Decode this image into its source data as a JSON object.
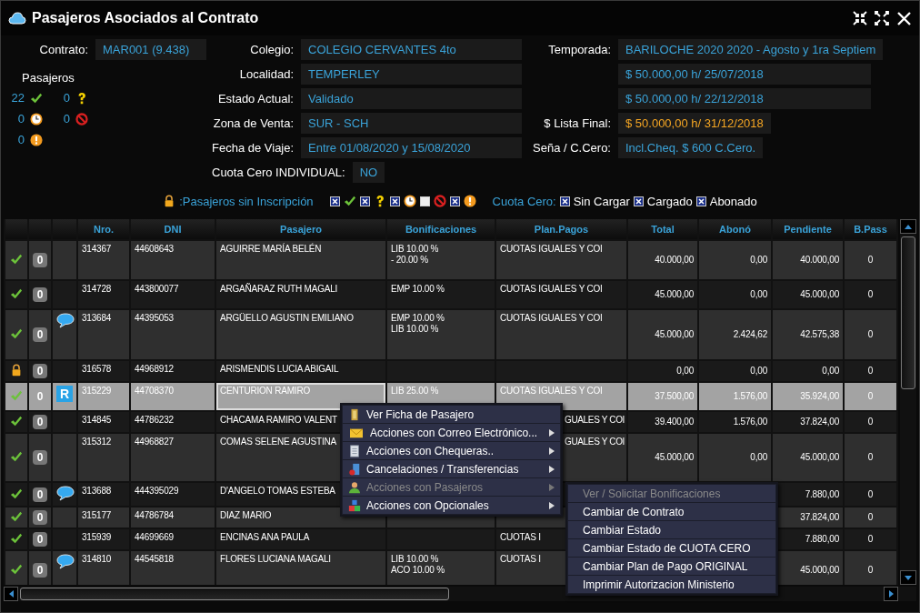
{
  "window": {
    "title": "Pasajeros Asociados al Contrato"
  },
  "contract": {
    "label": "Contrato:",
    "value": "MAR001 (9.438)"
  },
  "passenger_counts": {
    "title": "Pasajeros",
    "items": [
      {
        "kind": "ok",
        "count": "22"
      },
      {
        "kind": "question",
        "count": "0"
      },
      {
        "kind": "clock",
        "count": "0"
      },
      {
        "kind": "blocked",
        "count": "0"
      },
      {
        "kind": "warning",
        "count": "0"
      }
    ]
  },
  "details_middle": [
    {
      "kind": "field",
      "label": "Colegio:",
      "value": "COLEGIO CERVANTES 4to"
    },
    {
      "kind": "field",
      "label": "Localidad:",
      "value": "TEMPERLEY"
    },
    {
      "kind": "field",
      "label": "Estado Actual:",
      "value": "Validado"
    },
    {
      "kind": "field",
      "label": "Zona de Venta:",
      "value": "SUR - SCH"
    },
    {
      "kind": "field",
      "label": "Fecha de Viaje:",
      "value": "Entre 01/08/2020 y 15/08/2020"
    },
    {
      "kind": "compact",
      "label": "Cuota Cero INDIVIDUAL:",
      "value": "NO"
    }
  ],
  "details_right": [
    {
      "label": "Temporada:",
      "value": "BARILOCHE 2020 2020 - Agosto y 1ra Septiem",
      "highlight": false
    },
    {
      "value": "$ 50.000,00 h/ 25/07/2018",
      "highlight": false
    },
    {
      "value": "$ 50.000,00 h/ 22/12/2018",
      "highlight": false
    },
    {
      "label": "$ Lista Final:",
      "value": "$ 50.000,00 h/ 31/12/2018",
      "highlight": true
    },
    {
      "label": "Seña / C.Cero:",
      "value": "Incl.Cheq. $ 600 C.Cero.",
      "highlight": false
    }
  ],
  "legend": {
    "locked_label": ":Pasajeros sin Inscripción",
    "status_filters": [
      {
        "kind": "ok",
        "checked": true
      },
      {
        "kind": "question",
        "checked": true
      },
      {
        "kind": "clock",
        "checked": true
      },
      {
        "kind": "blocked",
        "checked": false
      },
      {
        "kind": "warning",
        "checked": true
      }
    ],
    "cuota_cero_label": "Cuota Cero:",
    "cuota_cero_filters": [
      {
        "label": "Sin Cargar",
        "checked": true
      },
      {
        "label": "Cargado",
        "checked": true
      },
      {
        "label": "Abonado",
        "checked": true
      }
    ]
  },
  "table": {
    "columns": [
      "Nro.",
      "DNI",
      "Pasajero",
      "Bonificaciones",
      "Plan.Pagos",
      "Total",
      "Abonó",
      "Pendiente",
      "B.Pass"
    ],
    "rows": [
      {
        "status": {
          "kind": "ok"
        },
        "badge": "0",
        "selected": false,
        "nro": "314367",
        "dni": "44608643",
        "pasajero": "AGUIRRE MARÍA BELÉN",
        "bonificaciones": [
          "LIB 10.00 %",
          "- 20.00 %"
        ],
        "plan": "CUOTAS IGUALES Y COI",
        "total": "40.000,00",
        "abono": "0,00",
        "pendiente": "40.000,00",
        "bpass": "0"
      },
      {
        "status": {
          "kind": "ok"
        },
        "badge": "0",
        "selected": false,
        "nro": "314728",
        "dni": "443800077",
        "pasajero": "ARGAÑARAZ RUTH MAGALI",
        "bonificaciones": [
          "EMP 10.00 %"
        ],
        "plan": "CUOTAS IGUALES Y COI",
        "total": "45.000,00",
        "abono": "0,00",
        "pendiente": "45.000,00",
        "bpass": "0"
      },
      {
        "status": {
          "kind": "ok"
        },
        "badge": "0",
        "note": {
          "kind": "chat"
        },
        "selected": false,
        "nro": "313684",
        "dni": "44395053",
        "pasajero": "ARGÜELLO AGUSTIN EMILIANO",
        "bonificaciones": [
          "EMP 10.00 %",
          "LIB 10.00 %"
        ],
        "plan": "CUOTAS IGUALES Y COI",
        "total": "45.000,00",
        "abono": "2.424,62",
        "pendiente": "42.575,38",
        "bpass": "0"
      },
      {
        "status": {
          "kind": "locked"
        },
        "badge": "0",
        "selected": false,
        "nro": "316578",
        "dni": "44968912",
        "pasajero": "ARISMENDIS LUCIA ABIGAIL",
        "total": "0,00",
        "abono": "0,00",
        "pendiente": "0,00",
        "bpass": "0"
      },
      {
        "status": {
          "kind": "ok"
        },
        "badge": "0",
        "note": {
          "kind": "letter",
          "text": "R"
        },
        "selected": true,
        "nro": "315229",
        "dni": "44708370",
        "pasajero": "CENTURION RAMIRO",
        "bonificaciones": [
          "LIB 25.00 %"
        ],
        "plan": "CUOTAS IGUALES Y COI",
        "total": "37.500,00",
        "abono": "1.576,00",
        "pendiente": "35.924,00",
        "bpass": "0"
      },
      {
        "status": {
          "kind": "ok"
        },
        "badge": "0",
        "selected": false,
        "nro": "314845",
        "dni": "44786232",
        "pasajero": "CHACAMA RAMIRO VALENT",
        "plan": "GUALES Y COI",
        "total": "39.400,00",
        "abono": "1.576,00",
        "pendiente": "37.824,00",
        "bpass": "0"
      },
      {
        "status": {
          "kind": "ok"
        },
        "badge": "0",
        "selected": false,
        "nro": "315312",
        "dni": "44968827",
        "pasajero": "COMAS SELENE AGUSTINA",
        "plan": "GUALES Y COI",
        "total": "45.000,00",
        "abono": "0,00",
        "pendiente": "45.000,00",
        "bpass": "0"
      },
      {
        "status": {
          "kind": "ok"
        },
        "badge": "0",
        "note": {
          "kind": "chat"
        },
        "selected": false,
        "nro": "313688",
        "dni": "444395029",
        "pasajero": "D'ANGELO TOMAS ESTEBA",
        "pendiente": "7.880,00",
        "bpass": "0"
      },
      {
        "status": {
          "kind": "ok"
        },
        "badge": "0",
        "selected": false,
        "nro": "315177",
        "dni": "44786784",
        "pasajero": "DIAZ MARIO",
        "pendiente": "37.824,00",
        "bpass": "0"
      },
      {
        "status": {
          "kind": "ok"
        },
        "badge": "0",
        "selected": false,
        "nro": "315939",
        "dni": "44699669",
        "pasajero": "ENCINAS ANA PAULA",
        "plan": "CUOTAS I",
        "pendiente": "7.880,00",
        "bpass": "0"
      },
      {
        "status": {
          "kind": "ok"
        },
        "badge": "0",
        "note": {
          "kind": "chat"
        },
        "selected": false,
        "nro": "314810",
        "dni": "44545818",
        "pasajero": "FLORES LUCIANA MAGALI",
        "bonificaciones": [
          "LIB 10.00 %",
          "ACO 10.00 %"
        ],
        "plan": "CUOTAS I",
        "pendiente": "45.000,00",
        "bpass": "0"
      }
    ]
  },
  "context_menu": {
    "items": [
      {
        "kind": "door",
        "label": "Ver Ficha de Pasajero",
        "submenu": false,
        "disabled": false
      },
      {
        "kind": "envelope",
        "label": "Acciones con Correo Electrónico...",
        "submenu": true,
        "disabled": false
      },
      {
        "kind": "document",
        "label": "Acciones con Chequeras..",
        "submenu": true,
        "disabled": false
      },
      {
        "kind": "cancel",
        "label": "Cancelaciones / Transferencias",
        "submenu": true,
        "disabled": false
      },
      {
        "kind": "person",
        "label": "Acciones con Pasajeros",
        "submenu": true,
        "disabled": true
      },
      {
        "kind": "blocks",
        "label": "Acciones con Opcionales",
        "submenu": true,
        "disabled": false
      }
    ]
  },
  "submenu": {
    "items": [
      {
        "label": "Ver / Solicitar Bonificaciones",
        "disabled": true
      },
      {
        "label": "Cambiar de Contrato",
        "disabled": false
      },
      {
        "label": "Cambiar Estado",
        "disabled": false
      },
      {
        "label": "Cambiar Estado de CUOTA CERO",
        "disabled": false
      },
      {
        "label": "Cambiar Plan de Pago ORIGINAL",
        "disabled": false
      },
      {
        "label": "Imprimir Autorizacion Ministerio",
        "disabled": false
      }
    ]
  }
}
